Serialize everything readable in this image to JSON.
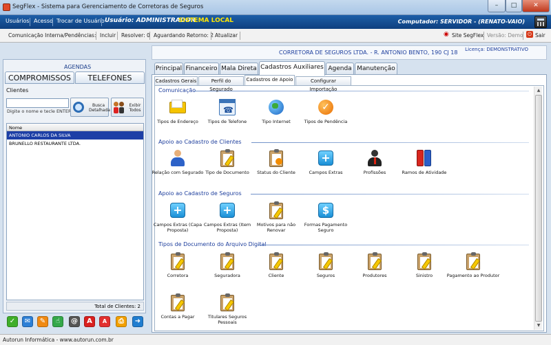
{
  "window": {
    "title": "SegFlex - Sistema para Gerenciamento de Corretoras de Seguros"
  },
  "menubar": {
    "items": [
      "Usuários",
      "Acesso",
      "Trocar de Usuário"
    ],
    "user": "Usuário: ADMINISTRADOR",
    "sistema": "SISTEMA LOCAL",
    "computer": "Computador: SERVIDOR - (RENATO-VAIO)"
  },
  "toolbar2": {
    "comunicacao": "Comunicação Interna/Pendências:",
    "incluir": "Incluir",
    "resolver": "Resolver: 0",
    "aguardando": "Aguardando Retorno: 2",
    "atualizar": "Atualizar",
    "site": "Site SegFlex",
    "versao": "Versão: Demo",
    "sair": "Sair"
  },
  "left": {
    "agendas": "AGENDAS",
    "compromissos": "COMPROMISSOS",
    "telefones": "TELEFONES",
    "clientes": "Clientes",
    "search_value": "",
    "search_hint": "Digite o nome e tecle ENTER",
    "busca_btn": "Busca Detalhada",
    "exibir_btn": "Exibir Todos",
    "list_header": "Nome",
    "rows": [
      "ANTONIO CARLOS DA SILVA",
      "BRUNELLO RESTAURANTE LTDA."
    ],
    "total": "Total de Clientes: 2"
  },
  "status": {
    "text": "Autorun Informática - www.autorun.com.br"
  },
  "header": {
    "company": "CORRETORA DE SEGUROS LTDA. - R. ANTONIO BENTO, 190 CJ 18",
    "licenca": "Licença: DEMONSTRATIVO"
  },
  "tabs": [
    "Principal",
    "Financeiro",
    "Mala Direta",
    "Cadastros Auxiliares",
    "Agenda",
    "Manutenção"
  ],
  "subtabs": [
    "Cadastros Gerais",
    "Perfil do Segurado",
    "Cadastros de Apoio",
    "Configurar Importação"
  ],
  "sections": {
    "comunicacao": {
      "title": "Comunicação",
      "items": [
        "Tipos de Endereço",
        "Tipos de Telefone",
        "Tipo Internet",
        "Tipos de Pendência"
      ]
    },
    "clientes": {
      "title": "Apoio ao Cadastro de Clientes",
      "items": [
        "Relação com Segurado",
        "Tipo de Documento",
        "Status do Cliente",
        "Campos Extras",
        "Profissões",
        "Ramos de Atividade"
      ]
    },
    "seguros": {
      "title": "Apoio ao Cadastro de Seguros",
      "items": [
        "Campos Extras (Capa Proposta)",
        "Campos Extras (Item Proposta)",
        "Motivos para não Renovar",
        "Formas Pagamento Seguro"
      ]
    },
    "arquivo": {
      "title": "Tipos de Documento do Arquivo Digital",
      "items": [
        "Corretora",
        "Seguradora",
        "Cliente",
        "Seguros",
        "Produtores",
        "Sinistro",
        "Pagamento ao Produtor",
        "Contas a Pagar",
        "Titulares Seguros Pessoais"
      ]
    }
  },
  "colors": {
    "menubar": "#0e3f7e",
    "accent": "#1c3d9c",
    "sistema": "#ffe600",
    "selection": "#1d3fa6"
  }
}
